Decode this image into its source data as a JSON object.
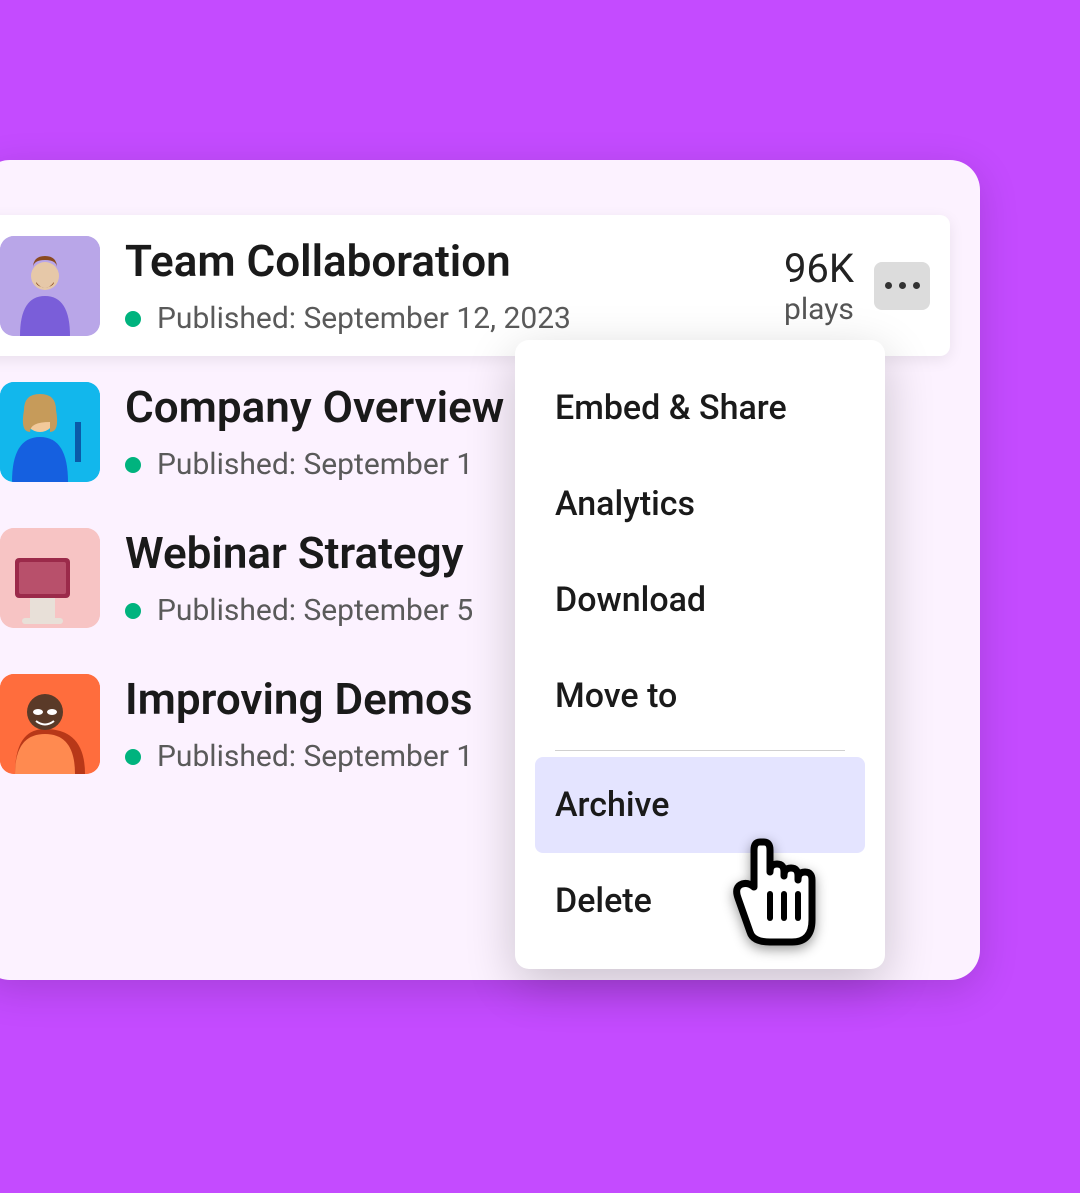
{
  "videos": [
    {
      "title": "Team Collaboration",
      "status_prefix": "Published:",
      "date": "September 12, 2023",
      "plays_value": "96K",
      "plays_label": "plays",
      "thumb_bg": "#b9a6e8",
      "active": true
    },
    {
      "title": "Company Overview",
      "status_prefix": "Published:",
      "date": "September 1",
      "thumb_bg": "#12b7ec",
      "active": false
    },
    {
      "title": "Webinar Strategy",
      "status_prefix": "Published:",
      "date": "September 5",
      "thumb_bg": "#f7c4c4",
      "active": false
    },
    {
      "title": "Improving Demos",
      "status_prefix": "Published:",
      "date": "September 1",
      "thumb_bg": "#ff6d3d",
      "active": false
    }
  ],
  "menu": {
    "embed_share": "Embed & Share",
    "analytics": "Analytics",
    "download": "Download",
    "move_to": "Move to",
    "archive": "Archive",
    "delete": "Delete"
  },
  "status_color": "#00b37e"
}
